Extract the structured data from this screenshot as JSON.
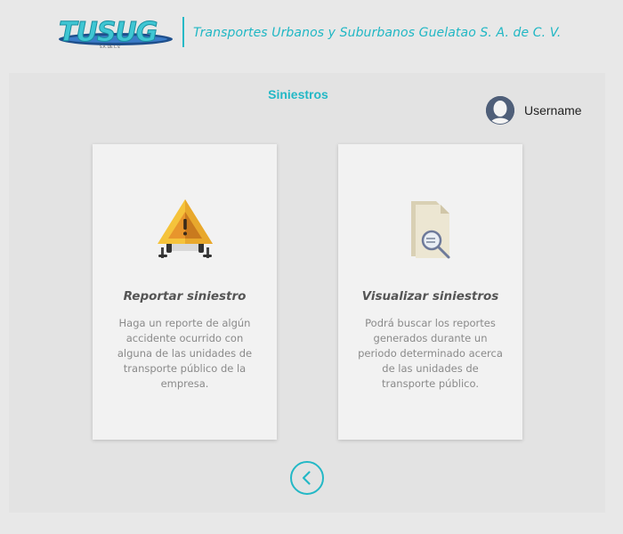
{
  "header": {
    "logo_text": "TUSUG",
    "company_name": "Transportes Urbanos y Suburbanos Guelatao S. A. de C. V."
  },
  "page": {
    "title": "Siniestros"
  },
  "user": {
    "name": "Username",
    "avatar_color": "#4f5f79"
  },
  "cards": [
    {
      "title": "Reportar siniestro",
      "description": "Haga un reporte de algún accidente ocurrido con alguna de las unidades de transporte público de la empresa.",
      "icon": "warning-sign-icon"
    },
    {
      "title": "Visualizar siniestros",
      "description": "Podrá buscar los reportes generados durante un periodo determinado acerca de las unidades de transporte público.",
      "icon": "document-search-icon"
    }
  ],
  "navigation": {
    "back_icon": "chevron-left-icon"
  },
  "colors": {
    "accent": "#23b8c6",
    "background": "#e8e8e8",
    "card_background": "#f2f2f2",
    "warning_yellow": "#f5c33b",
    "warning_orange": "#e8952c"
  }
}
